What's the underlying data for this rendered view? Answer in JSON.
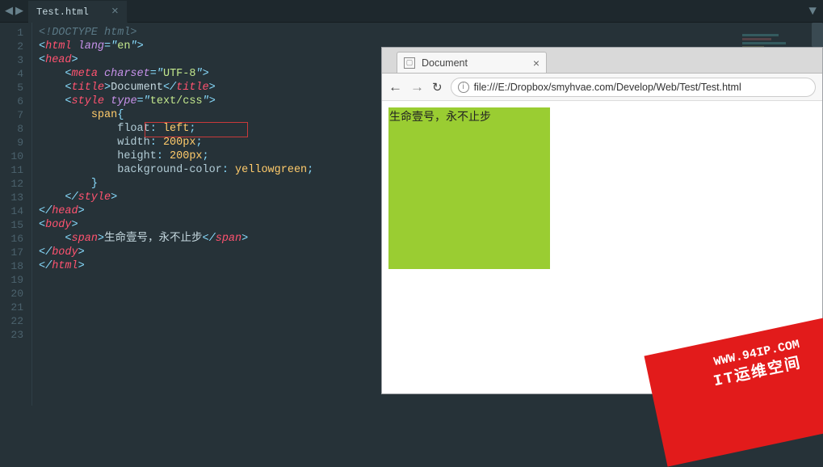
{
  "editor": {
    "tab_name": "Test.html",
    "line_count": 23,
    "code": {
      "l1": {
        "doctype": "<!",
        "keyword": "DOCTYPE html",
        "close": ">"
      },
      "l2": {
        "open": "<",
        "tag": "html",
        "sp": " ",
        "attr": "lang",
        "eq": "=",
        "q": "\"",
        "val": "en",
        "q2": "\"",
        "close": ">"
      },
      "l3": {
        "open": "<",
        "tag": "head",
        "close": ">"
      },
      "l4": {
        "open": "<",
        "tag": "meta",
        "sp": " ",
        "attr": "charset",
        "eq": "=",
        "q": "\"",
        "val": "UTF-8",
        "q2": "\"",
        "close": ">"
      },
      "l5": {
        "open": "<",
        "tag": "title",
        "close": ">",
        "text": "Document",
        "open2": "</",
        "tag2": "title",
        "close2": ">"
      },
      "l6": {
        "open": "<",
        "tag": "style",
        "sp": " ",
        "attr": "type",
        "eq": "=",
        "q": "\"",
        "val": "text/css",
        "q2": "\"",
        "close": ">"
      },
      "l7": {
        "sel": "span",
        "brace": "{"
      },
      "l8": {
        "prop": "float",
        "colon": ": ",
        "val": "left",
        "semi": ";"
      },
      "l9": {
        "prop": "width",
        "colon": ": ",
        "val": "200px",
        "semi": ";"
      },
      "l10": {
        "prop": "height",
        "colon": ": ",
        "val": "200px",
        "semi": ";"
      },
      "l11": {
        "prop": "background-color",
        "colon": ": ",
        "val": "yellowgreen",
        "semi": ";"
      },
      "l12": {
        "brace": "}"
      },
      "l13": {
        "open": "</",
        "tag": "style",
        "close": ">"
      },
      "l14": {
        "open": "</",
        "tag": "head",
        "close": ">"
      },
      "l15": {
        "open": "<",
        "tag": "body",
        "close": ">"
      },
      "l16": {
        "open": "<",
        "tag": "span",
        "close": ">",
        "text": "生命壹号，永不止步",
        "open2": "</",
        "tag2": "span",
        "close2": ">"
      },
      "l17": {
        "open": "</",
        "tag": "body",
        "close": ">"
      },
      "l18": {
        "open": "</",
        "tag": "html",
        "close": ">"
      }
    }
  },
  "browser": {
    "tab_title": "Document",
    "url": "file:///E:/Dropbox/smyhvae.com/Develop/Web/Test/Test.html",
    "rendered_text": "生命壹号，永不止步"
  },
  "watermark": {
    "url": "WWW.94IP.COM",
    "text": "IT运维空间"
  }
}
